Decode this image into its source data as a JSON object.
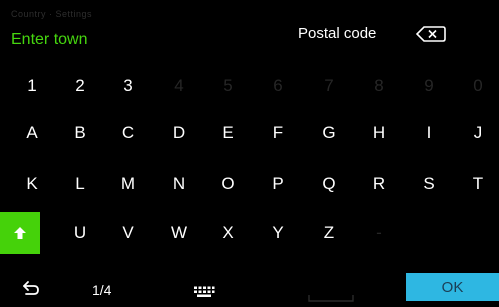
{
  "header": {
    "breadcrumb": "Country · Settings",
    "input_placeholder": "Enter town",
    "mode_label": "Postal code"
  },
  "keyboard": {
    "rows": [
      [
        {
          "label": "1",
          "enabled": true
        },
        {
          "label": "2",
          "enabled": true
        },
        {
          "label": "3",
          "enabled": true
        },
        {
          "label": "4",
          "enabled": false
        },
        {
          "label": "5",
          "enabled": false
        },
        {
          "label": "6",
          "enabled": false
        },
        {
          "label": "7",
          "enabled": false
        },
        {
          "label": "8",
          "enabled": false
        },
        {
          "label": "9",
          "enabled": false
        },
        {
          "label": "0",
          "enabled": false
        }
      ],
      [
        {
          "label": "A",
          "enabled": true
        },
        {
          "label": "B",
          "enabled": true
        },
        {
          "label": "C",
          "enabled": true
        },
        {
          "label": "D",
          "enabled": true
        },
        {
          "label": "E",
          "enabled": true
        },
        {
          "label": "F",
          "enabled": true
        },
        {
          "label": "G",
          "enabled": true
        },
        {
          "label": "H",
          "enabled": true
        },
        {
          "label": "I",
          "enabled": true
        },
        {
          "label": "J",
          "enabled": true
        }
      ],
      [
        {
          "label": "K",
          "enabled": true
        },
        {
          "label": "L",
          "enabled": true
        },
        {
          "label": "M",
          "enabled": true
        },
        {
          "label": "N",
          "enabled": true
        },
        {
          "label": "O",
          "enabled": true
        },
        {
          "label": "P",
          "enabled": true
        },
        {
          "label": "Q",
          "enabled": true
        },
        {
          "label": "R",
          "enabled": true
        },
        {
          "label": "S",
          "enabled": true
        },
        {
          "label": "T",
          "enabled": true
        }
      ],
      [
        {
          "label": "U",
          "enabled": true
        },
        {
          "label": "V",
          "enabled": true
        },
        {
          "label": "W",
          "enabled": true
        },
        {
          "label": "X",
          "enabled": true
        },
        {
          "label": "Y",
          "enabled": true
        },
        {
          "label": "Z",
          "enabled": true
        },
        {
          "label": "-",
          "enabled": false
        }
      ]
    ]
  },
  "footer": {
    "page_indicator": "1/4",
    "ok_label": "OK"
  },
  "icons": {
    "backspace": "backspace-icon",
    "shift": "shift-arrow-icon",
    "back": "back-arrow-icon",
    "keyboard": "keyboard-icon",
    "space": "space-bar-icon"
  },
  "colors": {
    "input_text": "#46d60f",
    "shift_key": "#45d20a",
    "ok_button": "#2eb7e2",
    "ok_text": "#1b3e55",
    "disabled_key": "#262626"
  }
}
